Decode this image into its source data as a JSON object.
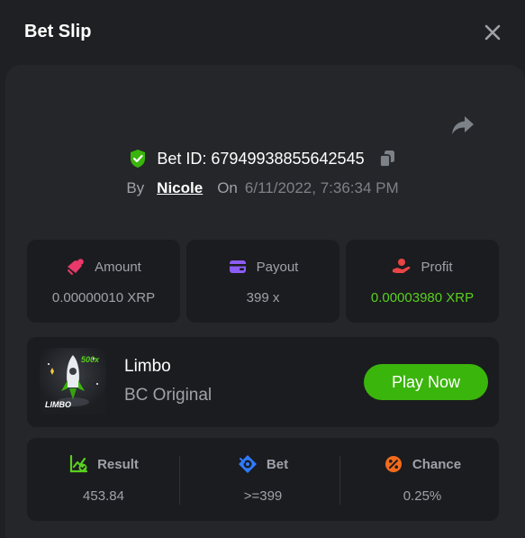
{
  "header": {
    "title": "Bet Slip"
  },
  "bet": {
    "id_text": "Bet ID: 67949938855642545",
    "by_label": "By",
    "user": "Nicole",
    "on_label": "On",
    "datetime": "6/11/2022, 7:36:34 PM"
  },
  "stats": {
    "amount_label": "Amount",
    "amount_value": "0.00000010 XRP",
    "payout_label": "Payout",
    "payout_value": "399 x",
    "profit_label": "Profit",
    "profit_value": "0.00003980 XRP"
  },
  "game": {
    "name": "Limbo",
    "subtitle": "BC Original",
    "thumb_label": "LIMBO",
    "thumb_badge": "500x",
    "play_label": "Play Now"
  },
  "result": {
    "result_label": "Result",
    "result_value": "453.84",
    "bet_label": "Bet",
    "bet_value": ">=399",
    "chance_label": "Chance",
    "chance_value": "0.25%"
  },
  "colors": {
    "accent_green": "#3ab50c",
    "profit_green": "#58d01f",
    "amount_pink": "#e8396a",
    "payout_purple": "#8b5cf6",
    "profit_red": "#e84545",
    "bet_blue": "#2f7bff",
    "chance_orange": "#f26a1b"
  },
  "icons": {
    "close": "close-icon",
    "share": "share-icon",
    "verified": "shield-check-icon",
    "copy": "copy-icon",
    "amount": "money-bag-icon",
    "payout": "wallet-icon",
    "profit": "hand-coin-icon",
    "result": "chart-check-icon",
    "bet": "target-icon",
    "chance": "percent-icon"
  }
}
